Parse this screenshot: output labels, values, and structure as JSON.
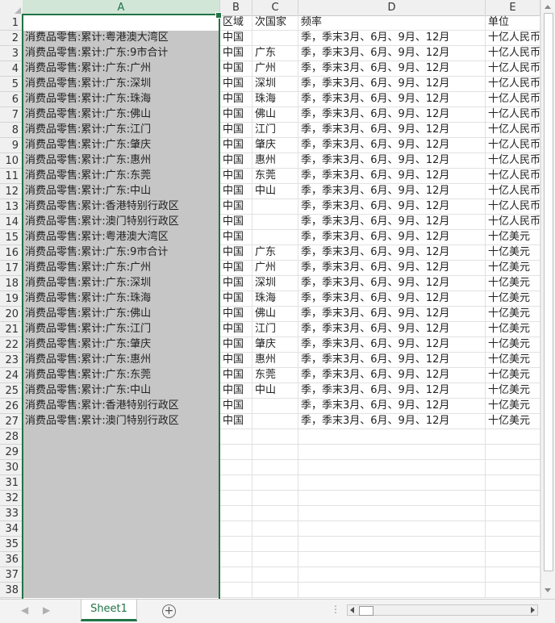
{
  "columns": [
    "A",
    "B",
    "C",
    "D",
    "E"
  ],
  "selected_column": "A",
  "header_row": {
    "b": "区域",
    "c": "次国家",
    "d": "频率",
    "e": "单位"
  },
  "rows": [
    {
      "a": "",
      "b": "区域",
      "c": "次国家",
      "d": "频率",
      "e": "单位"
    },
    {
      "a": "消费品零售:累计:粤港澳大湾区",
      "b": "中国",
      "c": "",
      "d": "季，季末3月、6月、9月、12月",
      "e": "十亿人民币"
    },
    {
      "a": "消费品零售:累计:广东:9市合计",
      "b": "中国",
      "c": "广东",
      "d": "季，季末3月、6月、9月、12月",
      "e": "十亿人民币"
    },
    {
      "a": "消费品零售:累计:广东:广州",
      "b": "中国",
      "c": "广州",
      "d": "季，季末3月、6月、9月、12月",
      "e": "十亿人民币"
    },
    {
      "a": "消费品零售:累计:广东:深圳",
      "b": "中国",
      "c": "深圳",
      "d": "季，季末3月、6月、9月、12月",
      "e": "十亿人民币"
    },
    {
      "a": "消费品零售:累计:广东:珠海",
      "b": "中国",
      "c": "珠海",
      "d": "季，季末3月、6月、9月、12月",
      "e": "十亿人民币"
    },
    {
      "a": "消费品零售:累计:广东:佛山",
      "b": "中国",
      "c": "佛山",
      "d": "季，季末3月、6月、9月、12月",
      "e": "十亿人民币"
    },
    {
      "a": "消费品零售:累计:广东:江门",
      "b": "中国",
      "c": "江门",
      "d": "季，季末3月、6月、9月、12月",
      "e": "十亿人民币"
    },
    {
      "a": "消费品零售:累计:广东:肇庆",
      "b": "中国",
      "c": "肇庆",
      "d": "季，季末3月、6月、9月、12月",
      "e": "十亿人民币"
    },
    {
      "a": "消费品零售:累计:广东:惠州",
      "b": "中国",
      "c": "惠州",
      "d": "季，季末3月、6月、9月、12月",
      "e": "十亿人民币"
    },
    {
      "a": "消费品零售:累计:广东:东莞",
      "b": "中国",
      "c": "东莞",
      "d": "季，季末3月、6月、9月、12月",
      "e": "十亿人民币"
    },
    {
      "a": "消费品零售:累计:广东:中山",
      "b": "中国",
      "c": "中山",
      "d": "季，季末3月、6月、9月、12月",
      "e": "十亿人民币"
    },
    {
      "a": "消费品零售:累计:香港特别行政区",
      "b": "中国",
      "c": "",
      "d": "季，季末3月、6月、9月、12月",
      "e": "十亿人民币"
    },
    {
      "a": "消费品零售:累计:澳门特别行政区",
      "b": "中国",
      "c": "",
      "d": "季，季末3月、6月、9月、12月",
      "e": "十亿人民币"
    },
    {
      "a": "消费品零售:累计:粤港澳大湾区",
      "b": "中国",
      "c": "",
      "d": "季，季末3月、6月、9月、12月",
      "e": "十亿美元"
    },
    {
      "a": "消费品零售:累计:广东:9市合计",
      "b": "中国",
      "c": "广东",
      "d": "季，季末3月、6月、9月、12月",
      "e": "十亿美元"
    },
    {
      "a": "消费品零售:累计:广东:广州",
      "b": "中国",
      "c": "广州",
      "d": "季，季末3月、6月、9月、12月",
      "e": "十亿美元"
    },
    {
      "a": "消费品零售:累计:广东:深圳",
      "b": "中国",
      "c": "深圳",
      "d": "季，季末3月、6月、9月、12月",
      "e": "十亿美元"
    },
    {
      "a": "消费品零售:累计:广东:珠海",
      "b": "中国",
      "c": "珠海",
      "d": "季，季末3月、6月、9月、12月",
      "e": "十亿美元"
    },
    {
      "a": "消费品零售:累计:广东:佛山",
      "b": "中国",
      "c": "佛山",
      "d": "季，季末3月、6月、9月、12月",
      "e": "十亿美元"
    },
    {
      "a": "消费品零售:累计:广东:江门",
      "b": "中国",
      "c": "江门",
      "d": "季，季末3月、6月、9月、12月",
      "e": "十亿美元"
    },
    {
      "a": "消费品零售:累计:广东:肇庆",
      "b": "中国",
      "c": "肇庆",
      "d": "季，季末3月、6月、9月、12月",
      "e": "十亿美元"
    },
    {
      "a": "消费品零售:累计:广东:惠州",
      "b": "中国",
      "c": "惠州",
      "d": "季，季末3月、6月、9月、12月",
      "e": "十亿美元"
    },
    {
      "a": "消费品零售:累计:广东:东莞",
      "b": "中国",
      "c": "东莞",
      "d": "季，季末3月、6月、9月、12月",
      "e": "十亿美元"
    },
    {
      "a": "消费品零售:累计:广东:中山",
      "b": "中国",
      "c": "中山",
      "d": "季，季末3月、6月、9月、12月",
      "e": "十亿美元"
    },
    {
      "a": "消费品零售:累计:香港特别行政区",
      "b": "中国",
      "c": "",
      "d": "季，季末3月、6月、9月、12月",
      "e": "十亿美元"
    },
    {
      "a": "消费品零售:累计:澳门特别行政区",
      "b": "中国",
      "c": "",
      "d": "季，季末3月、6月、9月、12月",
      "e": "十亿美元"
    }
  ],
  "row_numbers": [
    "1",
    "2",
    "3",
    "4",
    "5",
    "6",
    "7",
    "8",
    "9",
    "10",
    "11",
    "12",
    "13",
    "14",
    "15",
    "16",
    "17",
    "18",
    "19",
    "20",
    "21",
    "22",
    "23",
    "24",
    "25",
    "26",
    "27",
    "28",
    "29",
    "30",
    "31",
    "32",
    "33",
    "34",
    "35",
    "36",
    "37",
    "38"
  ],
  "sheet_tab": {
    "label": "Sheet1",
    "add_icon": "+"
  },
  "colors": {
    "accent": "#217346",
    "selected_fill": "#c6c6c6"
  }
}
